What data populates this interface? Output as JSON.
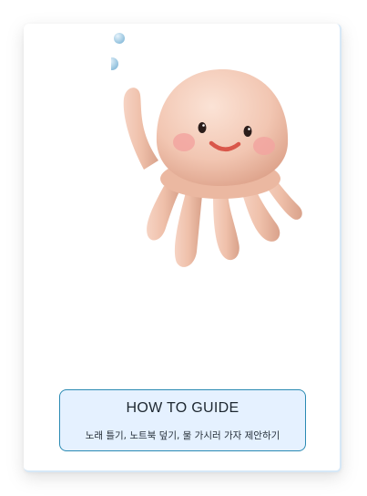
{
  "illustration": {
    "icon": "jellyfish-mascot-icon",
    "bubbles_icon": "bubbles-icon"
  },
  "guide": {
    "title": "HOW TO GUIDE",
    "subtitle": "노래 틀기, 노트북 덮기, 물 가시러 가자 제안하기"
  },
  "colors": {
    "card_border": "#d6e8f7",
    "guide_background": "#e5f1ff",
    "guide_border": "#2a8ab3",
    "mascot_body": "#f3c8b4"
  }
}
